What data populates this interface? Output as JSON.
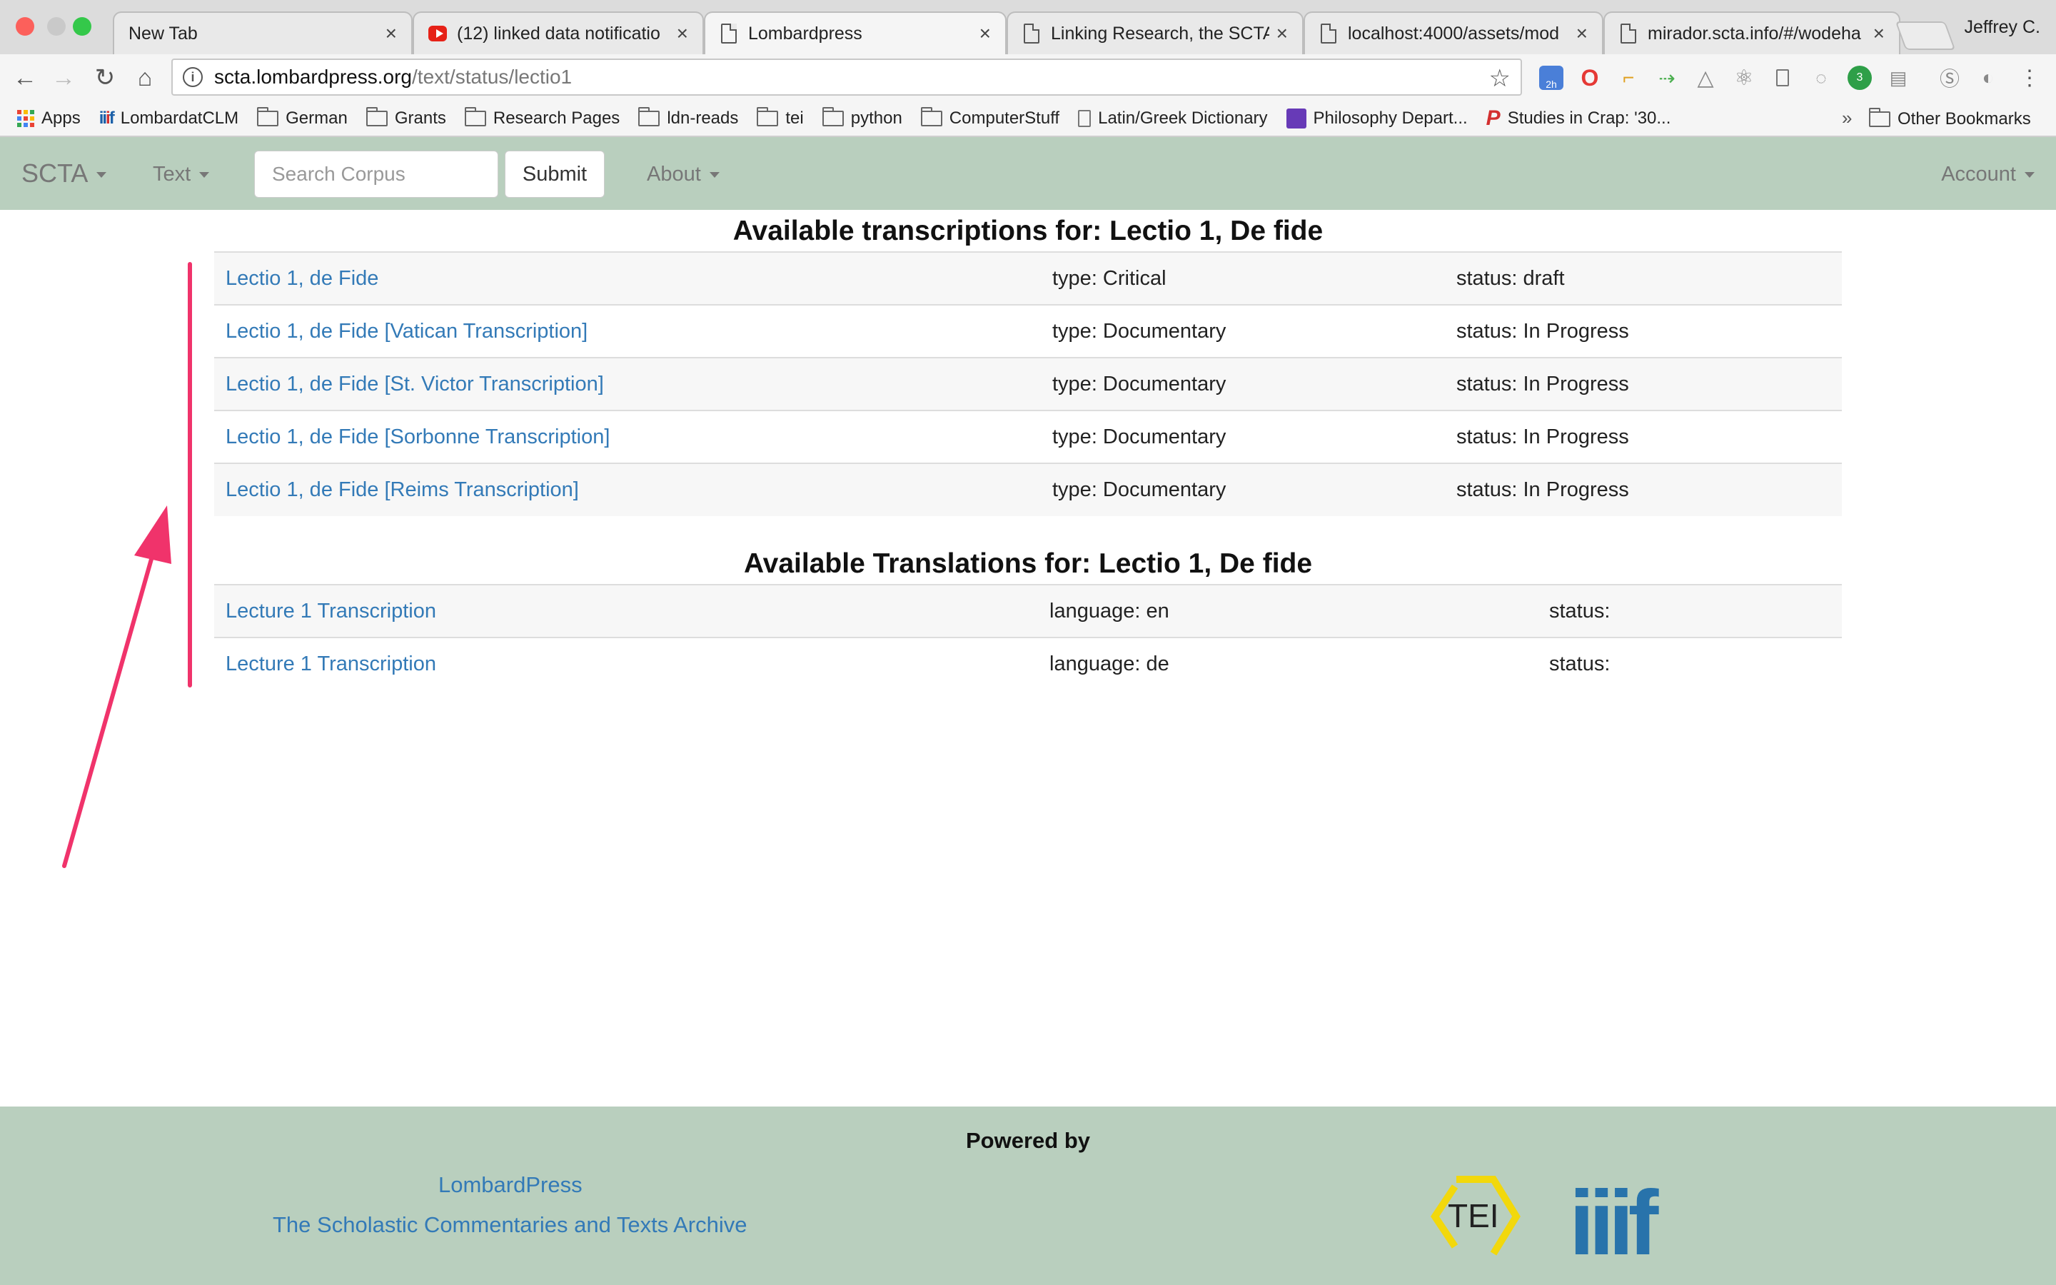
{
  "browser": {
    "tabs": [
      {
        "title": "New Tab",
        "icon": "blank-icon"
      },
      {
        "title": "(12) linked data notificatio",
        "icon": "youtube-icon"
      },
      {
        "title": "Lombardpress",
        "icon": "page-icon"
      },
      {
        "title": "Linking Research, the SCTA",
        "icon": "page-icon"
      },
      {
        "title": "localhost:4000/assets/mod",
        "icon": "page-icon"
      },
      {
        "title": "mirador.scta.info/#/wodeha",
        "icon": "page-icon"
      }
    ],
    "tab_close_glyph": "×",
    "profile_name": "Jeffrey C.",
    "url_host": "scta.lombardpress.org",
    "url_path": "/text/status/lectio1",
    "bookmarks": [
      {
        "label": "Apps",
        "icon": "apps-icon"
      },
      {
        "label": "LombardatCLM",
        "icon": "iiif-icon"
      },
      {
        "label": "German",
        "icon": "folder-icon"
      },
      {
        "label": "Grants",
        "icon": "folder-icon"
      },
      {
        "label": "Research Pages",
        "icon": "folder-icon"
      },
      {
        "label": "ldn-reads",
        "icon": "folder-icon"
      },
      {
        "label": "tei",
        "icon": "folder-icon"
      },
      {
        "label": "python",
        "icon": "folder-icon"
      },
      {
        "label": "ComputerStuff",
        "icon": "folder-icon"
      },
      {
        "label": "Latin/Greek Dictionary",
        "icon": "page-icon"
      },
      {
        "label": "Philosophy Depart...",
        "icon": "purple-icon"
      },
      {
        "label": "Studies in Crap: '30...",
        "icon": "p-icon"
      }
    ],
    "bookmarks_overflow": "»",
    "other_bookmarks": "Other Bookmarks",
    "extension_badges": {
      "calendar": "2h",
      "hangouts": "3"
    }
  },
  "navbar": {
    "brand": "SCTA",
    "text_menu": "Text",
    "search_placeholder": "Search Corpus",
    "submit_label": "Submit",
    "about_menu": "About",
    "account_menu": "Account"
  },
  "transcriptions": {
    "title": "Available transcriptions for: Lectio 1, De fide",
    "rows": [
      {
        "name": "Lectio 1, de Fide",
        "type": "type: Critical",
        "status": "status: draft"
      },
      {
        "name": "Lectio 1, de Fide [Vatican Transcription]",
        "type": "type: Documentary",
        "status": "status: In Progress"
      },
      {
        "name": "Lectio 1, de Fide [St. Victor Transcription]",
        "type": "type: Documentary",
        "status": "status: In Progress"
      },
      {
        "name": "Lectio 1, de Fide [Sorbonne Transcription]",
        "type": "type: Documentary",
        "status": "status: In Progress"
      },
      {
        "name": "Lectio 1, de Fide [Reims Transcription]",
        "type": "type: Documentary",
        "status": "status: In Progress"
      }
    ]
  },
  "translations": {
    "title": "Available Translations for: Lectio 1, De fide",
    "rows": [
      {
        "name": "Lecture 1 Transcription",
        "language": "language: en",
        "status": "status:"
      },
      {
        "name": "Lecture 1 Transcription",
        "language": "language: de",
        "status": "status:"
      }
    ]
  },
  "footer": {
    "powered_by": "Powered by",
    "lombardpress_link": "LombardPress",
    "scta_link": "The Scholastic Commentaries and Texts Archive",
    "tei_logo_text": "TEI",
    "iiif_logo_text": "iiif"
  },
  "annotation_color": "#f0336b"
}
